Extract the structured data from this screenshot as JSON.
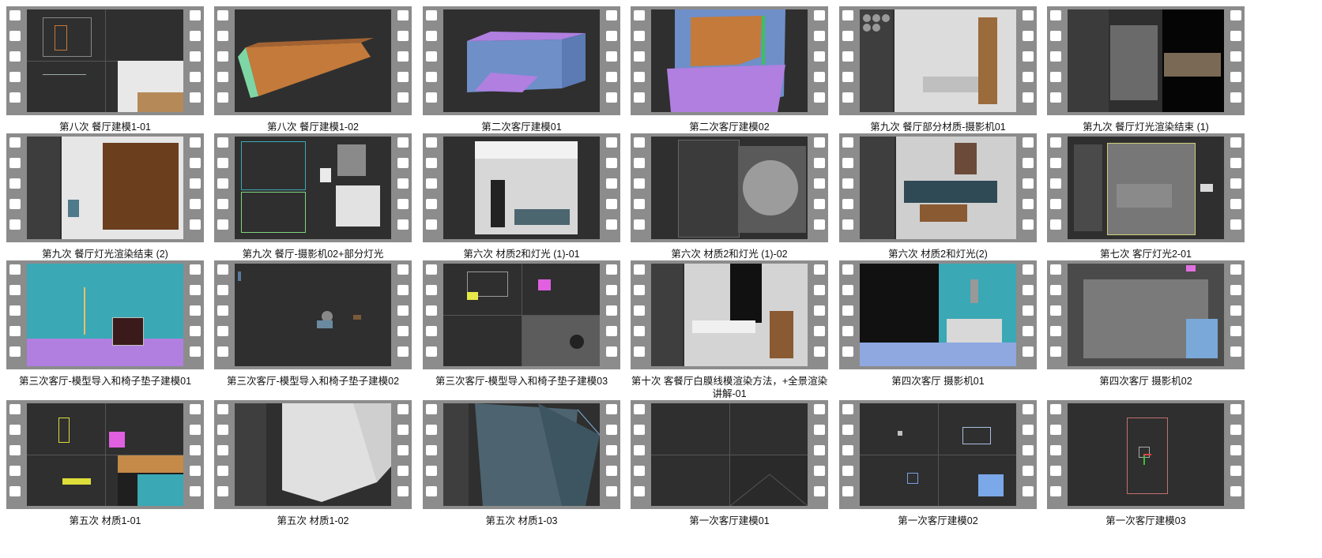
{
  "colors": {
    "strip": "#8c8c8c",
    "hole": "#ffffff",
    "viewport": "#2f2f2f",
    "caption": "#111111",
    "cyan": "#3aa8b5",
    "violet": "#b07fe0",
    "wood": "#c47a3a",
    "mint": "#7fd6a5"
  },
  "thumbnails": [
    {
      "caption": "第八次 餐厅建模1-01",
      "art": "quad"
    },
    {
      "caption": "第八次 餐厅建模1-02",
      "art": "wallbox"
    },
    {
      "caption": "第二次客厅建模01",
      "art": "bluebox"
    },
    {
      "caption": "第二次客厅建模02",
      "art": "ceilingbox"
    },
    {
      "caption": "第九次 餐厅部分材质-摄影机01",
      "art": "matroom"
    },
    {
      "caption": "第九次 餐厅灯光渲染结束 (1)",
      "art": "render"
    },
    {
      "caption": "第九次 餐厅灯光渲染结束 (2)",
      "art": "woodwall"
    },
    {
      "caption": "第九次 餐厅-摄影机02+部分灯光",
      "art": "plan"
    },
    {
      "caption": "第六次 材质2和灯光 (1)-01",
      "art": "sofaroom"
    },
    {
      "caption": "第六次 材质2和灯光 (1)-02",
      "art": "sphere"
    },
    {
      "caption": "第六次 材质2和灯光(2)",
      "art": "livingmat"
    },
    {
      "caption": "第七次 客厅灯光2-01",
      "art": "framed"
    },
    {
      "caption": "第三次客厅-模型导入和椅子垫子建模01",
      "art": "cyanroom"
    },
    {
      "caption": "第三次客厅-模型导入和椅子垫子建模02",
      "art": "empty"
    },
    {
      "caption": "第三次客厅-模型导入和椅子垫子建模03",
      "art": "chairquad"
    },
    {
      "caption": "第十次 客餐厅白膜线模渲染方法，+全景渲染讲解-01",
      "art": "dining"
    },
    {
      "caption": "第四次客厅 摄影机01",
      "art": "cyanliving"
    },
    {
      "caption": "第四次客厅 摄影机02",
      "art": "overlay"
    },
    {
      "caption": "第五次 材质1-01",
      "art": "quad2"
    },
    {
      "caption": "第五次 材质1-02",
      "art": "whitebox"
    },
    {
      "caption": "第五次 材质1-03",
      "art": "curtain"
    },
    {
      "caption": "第一次客厅建模01",
      "art": "gridquad"
    },
    {
      "caption": "第一次客厅建模02",
      "art": "gridbox"
    },
    {
      "caption": "第一次客厅建模03",
      "art": "planrect"
    }
  ]
}
